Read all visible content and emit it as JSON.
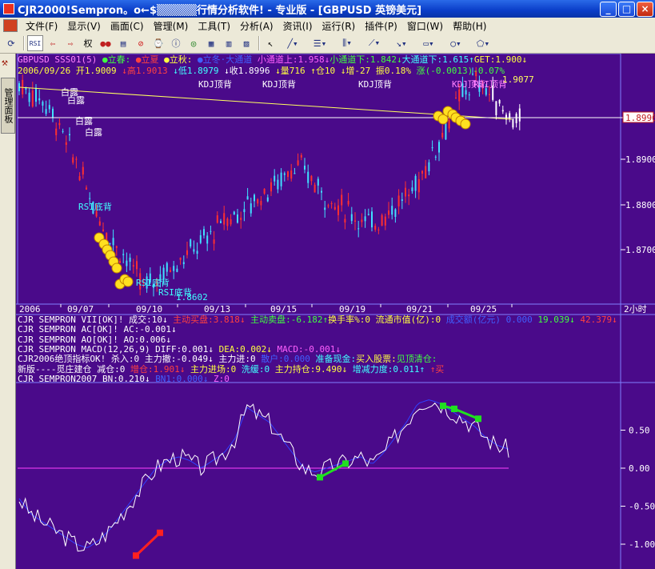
{
  "window": {
    "title": "CJR2000!Sempron。o←$▒▒▒▒▒行情分析软件! - 专业版 - [GBPUSD 英镑美元]",
    "min": "_",
    "max": "□",
    "close": "×"
  },
  "menu": [
    "文件(F)",
    "显示(V)",
    "画面(C)",
    "管理(M)",
    "工具(T)",
    "分析(A)",
    "资讯(I)",
    "运行(R)",
    "插件(P)",
    "窗口(W)",
    "帮助(H)"
  ],
  "toolbar": {
    "right_label": "权"
  },
  "sidebar": {
    "tab_label": "管理面板"
  },
  "main_chart": {
    "header_line1": [
      {
        "t": "GBPUSD SSS01(5)",
        "c": "#ff80ff"
      },
      {
        "t": " ●立春:",
        "c": "#40ff40"
      },
      {
        "t": " ●立夏",
        "c": "#ff4040"
      },
      {
        "t": " ●立秋:",
        "c": "#ffff40"
      },
      {
        "t": " ●立冬·大通道",
        "c": "#4060ff"
      },
      {
        "t": "  小通道上:1.958↓",
        "c": "#ff60ff"
      },
      {
        "t": "小通道下:1.842↓",
        "c": "#40ff40"
      },
      {
        "t": "大通道下:1.615↑",
        "c": "#40ffff"
      },
      {
        "t": "GET:1.900↓",
        "c": "#ffff40"
      }
    ],
    "header_line2": [
      {
        "t": "2006/09/26 开1.9009",
        "c": "#ffff40"
      },
      {
        "t": " ↓高1.9013",
        "c": "#ff4040"
      },
      {
        "t": " ↓低1.8979",
        "c": "#40ffff"
      },
      {
        "t": " ↓收1.8996",
        "c": "#ffffff"
      },
      {
        "t": " ↓量716",
        "c": "#ffff40"
      },
      {
        "t": " ↑仓10",
        "c": "#ffff40"
      },
      {
        "t": " ↓增-27",
        "c": "#ffff40"
      },
      {
        "t": " 振0.18%",
        "c": "#ffff40"
      },
      {
        "t": " 涨(-0.0013)-0.07%",
        "c": "#40ff40"
      }
    ],
    "annotations": {
      "kdj1": "KDJ顶背",
      "kdj2": "KDJ顶背",
      "kdj3": "KDJ顶背",
      "kdj4": "KDJ顶背",
      "rsi_top": "RSI顶背",
      "rsi_bottom1": "RSI底背",
      "rsi_bottom2": "RSI底背",
      "rsi_bottom3": "RSI底背",
      "bailu": "白露",
      "high_label": "1.9077",
      "low_label": "1.8602"
    },
    "price_axis": [
      "1.8996",
      "1.8900",
      "1.8800",
      "1.8700"
    ],
    "date_axis": [
      "2006",
      "09/07",
      "09/10",
      "09/13",
      "09/15",
      "09/19",
      "09/21",
      "09/25"
    ],
    "period": "2小时"
  },
  "indicators": [
    [
      {
        "t": "CJR SEMPRON VII[OK]! 成交:10↓ ",
        "c": "#ffffff"
      },
      {
        "t": "主动买盘:3.818↓ ",
        "c": "#ff4040"
      },
      {
        "t": "主动卖盘:-6.182↑",
        "c": "#40ff40"
      },
      {
        "t": "换手率%:0 流通市值(亿):0 ",
        "c": "#ffff40"
      },
      {
        "t": "成交额(亿元) 0.000 ",
        "c": "#4060ff"
      },
      {
        "t": "19.039↓ ",
        "c": "#40ff40"
      },
      {
        "t": "42.379↓",
        "c": "#ff4040"
      }
    ],
    [
      {
        "t": "CJR SEMPRON  AC[OK]! AC:-0.001↓",
        "c": "#ffffff"
      }
    ],
    [
      {
        "t": "CJR SEMPRON AO[OK]! AO:0.006↓",
        "c": "#ffffff"
      }
    ],
    [
      {
        "t": "CJR SEMPRON MACD(12,26,9) DIFF:0.001↓ ",
        "c": "#ffffff"
      },
      {
        "t": "DEA:0.002↓ ",
        "c": "#ffff40"
      },
      {
        "t": "MACD:-0.001↓",
        "c": "#ff60ff"
      }
    ],
    [
      {
        "t": "CJR2006绝顶指标OK! 杀入:0 主力撤:-0.049↓ 主力进:0 ",
        "c": "#ffffff"
      },
      {
        "t": "散户:0.000 ",
        "c": "#4060ff"
      },
      {
        "t": "准备现金:",
        "c": "#40ffff"
      },
      {
        "t": "买入股票:",
        "c": "#ffff40"
      },
      {
        "t": "见顶清仓:",
        "c": "#40ff40"
      }
    ],
    [
      {
        "t": "新版----觅庄建仓 减仓:0 ",
        "c": "#ffffff"
      },
      {
        "t": "增仓:1.901↓ ",
        "c": "#ff4040"
      },
      {
        "t": "主力进场:0 ",
        "c": "#ffff40"
      },
      {
        "t": "洗缓:0 ",
        "c": "#40ffff"
      },
      {
        "t": "主力持仓:9.490↓ ",
        "c": "#ffff40"
      },
      {
        "t": "增减力度:0.011↑ ",
        "c": "#40ffff"
      },
      {
        "t": "↑买",
        "c": "#ff4040"
      }
    ],
    [
      {
        "t": "CJR SEMPRON2007 BN:0.210↓ ",
        "c": "#ffffff"
      },
      {
        "t": "BN1:0.000↓ ",
        "c": "#4060ff"
      },
      {
        "t": "Z:0",
        "c": "#ff60ff"
      }
    ]
  ],
  "osc_axis": [
    "0.50",
    "0.00",
    "-0.50",
    "-1.00"
  ]
}
